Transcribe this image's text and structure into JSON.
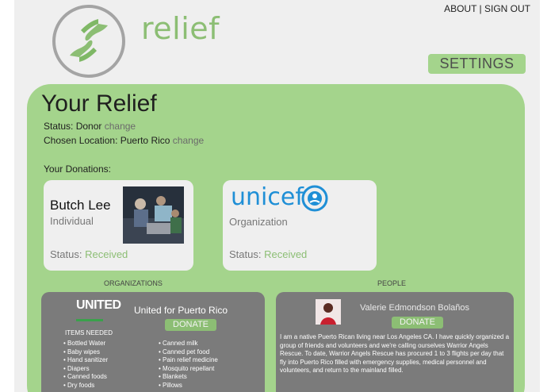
{
  "app": {
    "brand": "relief"
  },
  "topnav": {
    "about": "ABOUT",
    "separator": " | ",
    "signout": "SIGN OUT"
  },
  "settings_label": "SETTINGS",
  "panel": {
    "title": "Your Relief",
    "status_label": "Status:",
    "status_value": "Donor",
    "location_label": "Chosen Location:",
    "location_value": "Puerto Rico",
    "change_label": "change",
    "donations_label": "Your Donations:"
  },
  "donations": [
    {
      "name": "Butch Lee",
      "type": "Individual",
      "status_label": "Status:",
      "status_value": "Received"
    },
    {
      "name": "unicef",
      "type": "Organization",
      "status_label": "Status:",
      "status_value": "Received"
    }
  ],
  "organizations": {
    "header": "ORGANIZATIONS",
    "logo_text": "UNITED",
    "name": "United for Puerto Rico",
    "donate_label": "DONATE",
    "items_title": "ITEMS NEEDED",
    "items_left": [
      "Bottled Water",
      "Baby wipes",
      "Hand sanitizer",
      "Diapers",
      "Canned foods",
      "Dry foods"
    ],
    "items_right": [
      "Canned milk",
      "Canned pet food",
      "Pain relief medicine",
      "Mosquito repellant",
      "Blankets",
      "Pillows"
    ]
  },
  "people": {
    "header": "PEOPLE",
    "name": "Valerie Edmondson Bolaños",
    "donate_label": "DONATE",
    "bio": "I am a native Puerto Rican living near Los Angeles CA. I have quickly organized a group of friends and volunteers and we're calling ourselves Warrior Angels Rescue. To date, Warrior Angels Rescue has procured 1 to 3 flights per day that fly into Puerto Rico filled with emergency supplies, medical personnel and volunteers, and return to the mainland filled."
  },
  "colors": {
    "accent_green": "#8cbe74",
    "panel_green": "#a4d48c",
    "card_gray": "#7b7b7b",
    "unicef_blue": "#1f8fd6"
  }
}
